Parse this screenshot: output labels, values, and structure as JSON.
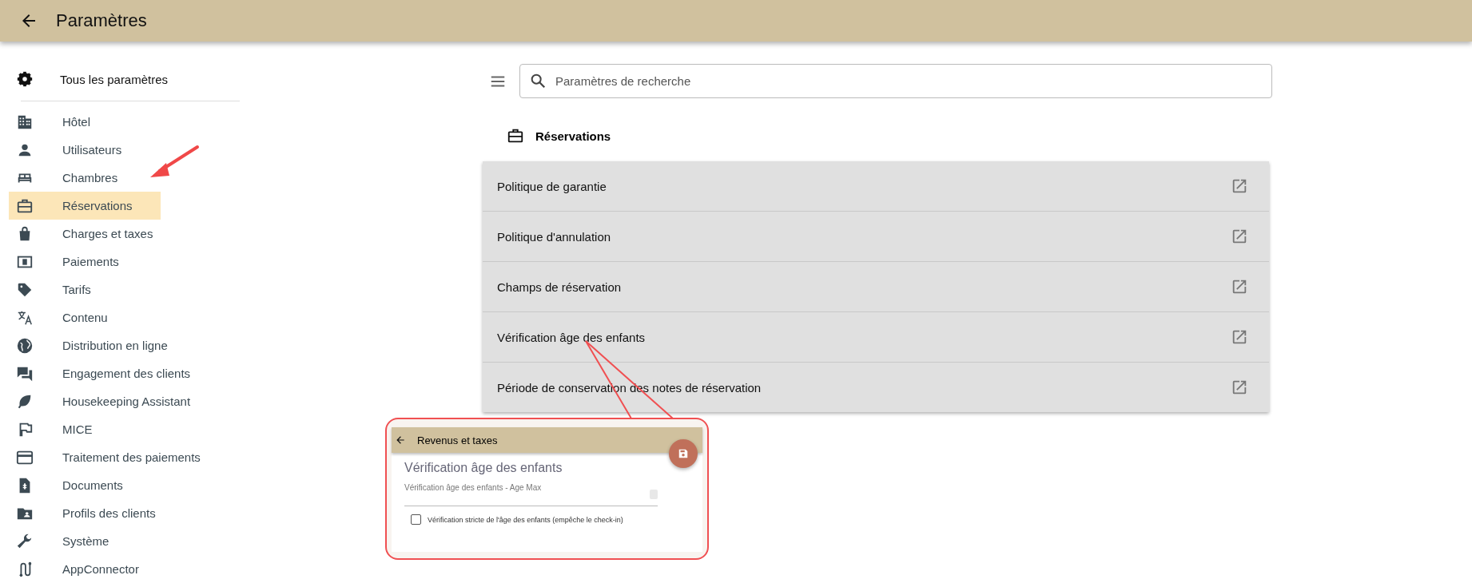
{
  "header": {
    "title": "Paramètres"
  },
  "sidebar": {
    "all_settings": "Tous les paramètres",
    "items": [
      {
        "label": "Hôtel",
        "selected": false
      },
      {
        "label": "Utilisateurs",
        "selected": false
      },
      {
        "label": "Chambres",
        "selected": false
      },
      {
        "label": "Réservations",
        "selected": true
      },
      {
        "label": "Charges et taxes",
        "selected": false
      },
      {
        "label": "Paiements",
        "selected": false
      },
      {
        "label": "Tarifs",
        "selected": false
      },
      {
        "label": "Contenu",
        "selected": false
      },
      {
        "label": "Distribution en ligne",
        "selected": false
      },
      {
        "label": "Engagement des clients",
        "selected": false
      },
      {
        "label": "Housekeeping Assistant",
        "selected": false
      },
      {
        "label": "MICE",
        "selected": false
      },
      {
        "label": "Traitement des paiements",
        "selected": false
      },
      {
        "label": "Documents",
        "selected": false
      },
      {
        "label": "Profils des clients",
        "selected": false
      },
      {
        "label": "Système",
        "selected": false
      },
      {
        "label": "AppConnector",
        "selected": false
      }
    ]
  },
  "search": {
    "placeholder": "Paramètres de recherche"
  },
  "section": {
    "title": "Réservations",
    "items": [
      "Politique de garantie",
      "Politique d'annulation",
      "Champs de réservation",
      "Vérification âge des enfants",
      "Période de conservation des notes de réservation"
    ]
  },
  "callout": {
    "title": "Revenus et taxes",
    "heading": "Vérification âge des enfants",
    "field_label": "Vérification âge des enfants - Age Max",
    "checkbox": {
      "label": "Vérification stricte de l'âge des enfants (empêche le check-in)",
      "checked": false
    }
  }
}
